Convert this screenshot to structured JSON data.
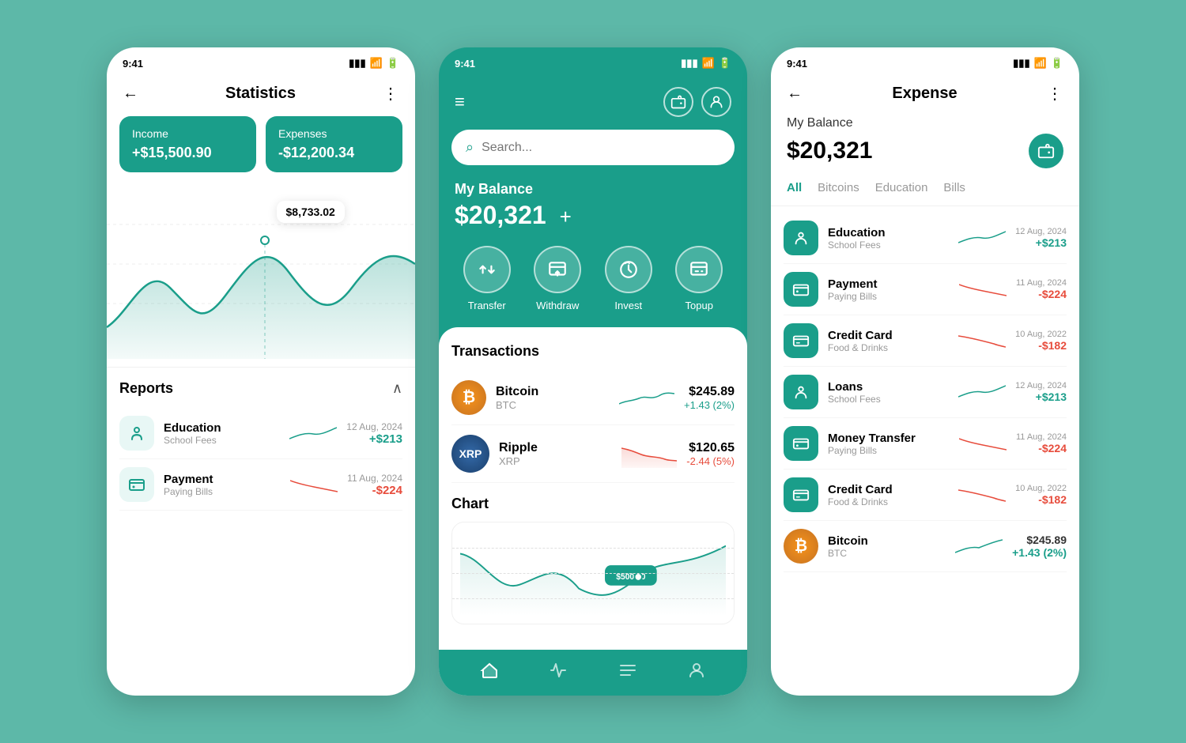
{
  "left": {
    "status_time": "9:41",
    "title": "Statistics",
    "income_label": "Income",
    "income_value": "+$15,500.90",
    "expenses_label": "Expenses",
    "expenses_value": "-$12,200.34",
    "tooltip_value": "$8,733.02",
    "reports_title": "Reports",
    "reports": [
      {
        "name": "Education",
        "sub": "School Fees",
        "date": "12 Aug, 2024",
        "amount": "+$213",
        "positive": true,
        "icon": "🎓"
      },
      {
        "name": "Payment",
        "sub": "Paying Bills",
        "date": "11 Aug, 2024",
        "amount": "-$224",
        "positive": false,
        "icon": "💳"
      }
    ]
  },
  "middle": {
    "status_time": "9:41",
    "search_placeholder": "Search...",
    "balance_label": "My Balance",
    "balance_amount": "$20,321",
    "actions": [
      {
        "label": "Transfer",
        "icon": "⇅"
      },
      {
        "label": "Withdraw",
        "icon": "↓"
      },
      {
        "label": "Invest",
        "icon": "🌱"
      },
      {
        "label": "Topup",
        "icon": "⊞"
      }
    ],
    "transactions_title": "Transactions",
    "transactions": [
      {
        "name": "Bitcoin",
        "sub": "BTC",
        "amount": "$245.89",
        "change": "+1.43 (2%)",
        "positive": true
      },
      {
        "name": "Ripple",
        "sub": "XRP",
        "amount": "$120.65",
        "change": "-2.44 (5%)",
        "positive": false
      }
    ],
    "chart_title": "Chart",
    "chart_tooltip": "$500.00",
    "nav_items": [
      "home",
      "pulse",
      "list",
      "person"
    ]
  },
  "right": {
    "status_time": "9:41",
    "title": "Expense",
    "balance_label": "My Balance",
    "balance_amount": "$20,321",
    "tabs": [
      "All",
      "Bitcoins",
      "Education",
      "Bills"
    ],
    "active_tab": "All",
    "expenses": [
      {
        "name": "Education",
        "sub": "School Fees",
        "date": "12 Aug, 2024",
        "amount": "+$213",
        "positive": true,
        "icon": "🎓"
      },
      {
        "name": "Payment",
        "sub": "Paying Bills",
        "date": "11 Aug, 2024",
        "amount": "-$224",
        "positive": false,
        "icon": "💳"
      },
      {
        "name": "Credit Card",
        "sub": "Food & Drinks",
        "date": "10 Aug, 2022",
        "amount": "-$182",
        "positive": false,
        "icon": "💳"
      },
      {
        "name": "Loans",
        "sub": "School Fees",
        "date": "12 Aug, 2024",
        "amount": "+$213",
        "positive": true,
        "icon": "🎓"
      },
      {
        "name": "Money Transfer",
        "sub": "Paying Bills",
        "date": "11 Aug, 2024",
        "amount": "-$224",
        "positive": false,
        "icon": "💳"
      },
      {
        "name": "Credit Card",
        "sub": "Food & Drinks",
        "date": "10 Aug, 2022",
        "amount": "-$182",
        "positive": false,
        "icon": "💳"
      },
      {
        "name": "Bitcoin",
        "sub": "BTC",
        "date": "",
        "amount": "$245.89",
        "change": "+1.43 (2%)",
        "positive": true,
        "is_btc": true
      }
    ]
  }
}
